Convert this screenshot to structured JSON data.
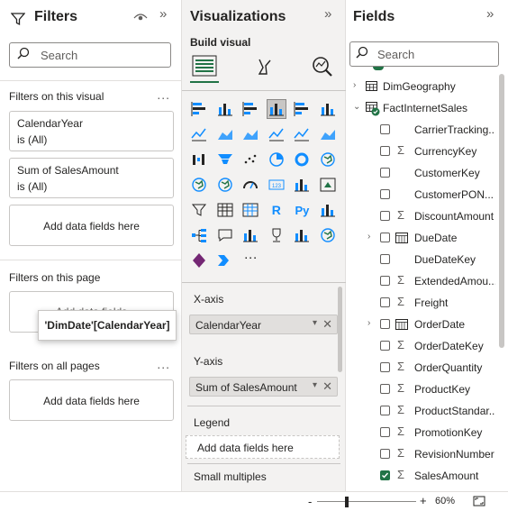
{
  "filters": {
    "title": "Filters",
    "search_placeholder": "Search",
    "sections": {
      "on_visual": "Filters on this visual",
      "on_page": "Filters on this page",
      "on_all_pages": "Filters on all pages",
      "more": "..."
    },
    "visual_cards": [
      {
        "field": "CalendarYear",
        "state": "is (All)"
      },
      {
        "field": "Sum of SalesAmount",
        "state": "is (All)"
      }
    ],
    "add_fields_label": "Add data fields here",
    "page_add_partial": "Add data fields",
    "drag_tooltip": "'DimDate'[CalendarYear]"
  },
  "visualizations": {
    "title": "Visualizations",
    "build_visual_label": "Build visual",
    "more_visuals": "...",
    "wells": [
      {
        "label": "X-axis",
        "value": "CalendarYear"
      },
      {
        "label": "Y-axis",
        "value": "Sum of SalesAmount"
      },
      {
        "label": "Legend",
        "value": "Add data fields here"
      },
      {
        "label": "Small multiples",
        "value": ""
      }
    ],
    "visual_icons": [
      "stacked-bar-chart-icon",
      "stacked-column-chart-icon",
      "clustered-bar-chart-icon",
      "clustered-column-chart-icon",
      "100-stacked-bar-chart-icon",
      "100-stacked-column-chart-icon",
      "line-chart-icon",
      "area-chart-icon",
      "stacked-area-chart-icon",
      "line-and-stacked-column-chart-icon",
      "line-and-clustered-column-chart-icon",
      "ribbon-chart-icon",
      "waterfall-chart-icon",
      "funnel-chart-icon",
      "scatter-chart-icon",
      "pie-chart-icon",
      "donut-chart-icon",
      "treemap-icon",
      "map-icon",
      "filled-map-icon",
      "gauge-icon",
      "card-icon",
      "multi-row-card-icon",
      "kpi-icon",
      "slicer-icon",
      "table-icon",
      "matrix-icon",
      "r-visual-icon",
      "python-visual-icon",
      "key-influencers-icon",
      "decomposition-tree-icon",
      "qa-icon",
      "smart-narrative-icon",
      "metrics-icon",
      "paginated-report-icon",
      "azure-map-icon",
      "power-apps-icon",
      "power-automate-icon",
      "more-visuals-icon"
    ]
  },
  "fields": {
    "title": "Fields",
    "search_placeholder": "Search",
    "tables": [
      {
        "name": "DimGeography",
        "expanded": false
      },
      {
        "name": "FactInternetSales",
        "expanded": true
      }
    ],
    "columns": [
      {
        "name": "CarrierTracking...",
        "sigma": false,
        "checked": false,
        "expandable": false
      },
      {
        "name": "CurrencyKey",
        "sigma": true,
        "checked": false,
        "expandable": false
      },
      {
        "name": "CustomerKey",
        "sigma": false,
        "checked": false,
        "expandable": false
      },
      {
        "name": "CustomerPON...",
        "sigma": false,
        "checked": false,
        "expandable": false
      },
      {
        "name": "DiscountAmount",
        "sigma": true,
        "checked": false,
        "expandable": false
      },
      {
        "name": "DueDate",
        "sigma": false,
        "checked": false,
        "expandable": true
      },
      {
        "name": "DueDateKey",
        "sigma": false,
        "checked": false,
        "expandable": false
      },
      {
        "name": "ExtendedAmou...",
        "sigma": true,
        "checked": false,
        "expandable": false
      },
      {
        "name": "Freight",
        "sigma": true,
        "checked": false,
        "expandable": false
      },
      {
        "name": "OrderDate",
        "sigma": false,
        "checked": false,
        "expandable": true
      },
      {
        "name": "OrderDateKey",
        "sigma": true,
        "checked": false,
        "expandable": false
      },
      {
        "name": "OrderQuantity",
        "sigma": true,
        "checked": false,
        "expandable": false
      },
      {
        "name": "ProductKey",
        "sigma": true,
        "checked": false,
        "expandable": false
      },
      {
        "name": "ProductStandar...",
        "sigma": true,
        "checked": false,
        "expandable": false
      },
      {
        "name": "PromotionKey",
        "sigma": true,
        "checked": false,
        "expandable": false
      },
      {
        "name": "RevisionNumber",
        "sigma": true,
        "checked": false,
        "expandable": false
      },
      {
        "name": "SalesAmount",
        "sigma": true,
        "checked": true,
        "expandable": false
      }
    ]
  },
  "status": {
    "zoom_minus": "-",
    "zoom_plus": "+",
    "zoom_level": "60%",
    "zoom_fraction": 0.3
  },
  "colors": {
    "accent": "#217346",
    "viz_pane_bg": "#f3f2f1",
    "selected_visual_bg": "#c8c6c4",
    "icon_blue": "#118dff"
  }
}
